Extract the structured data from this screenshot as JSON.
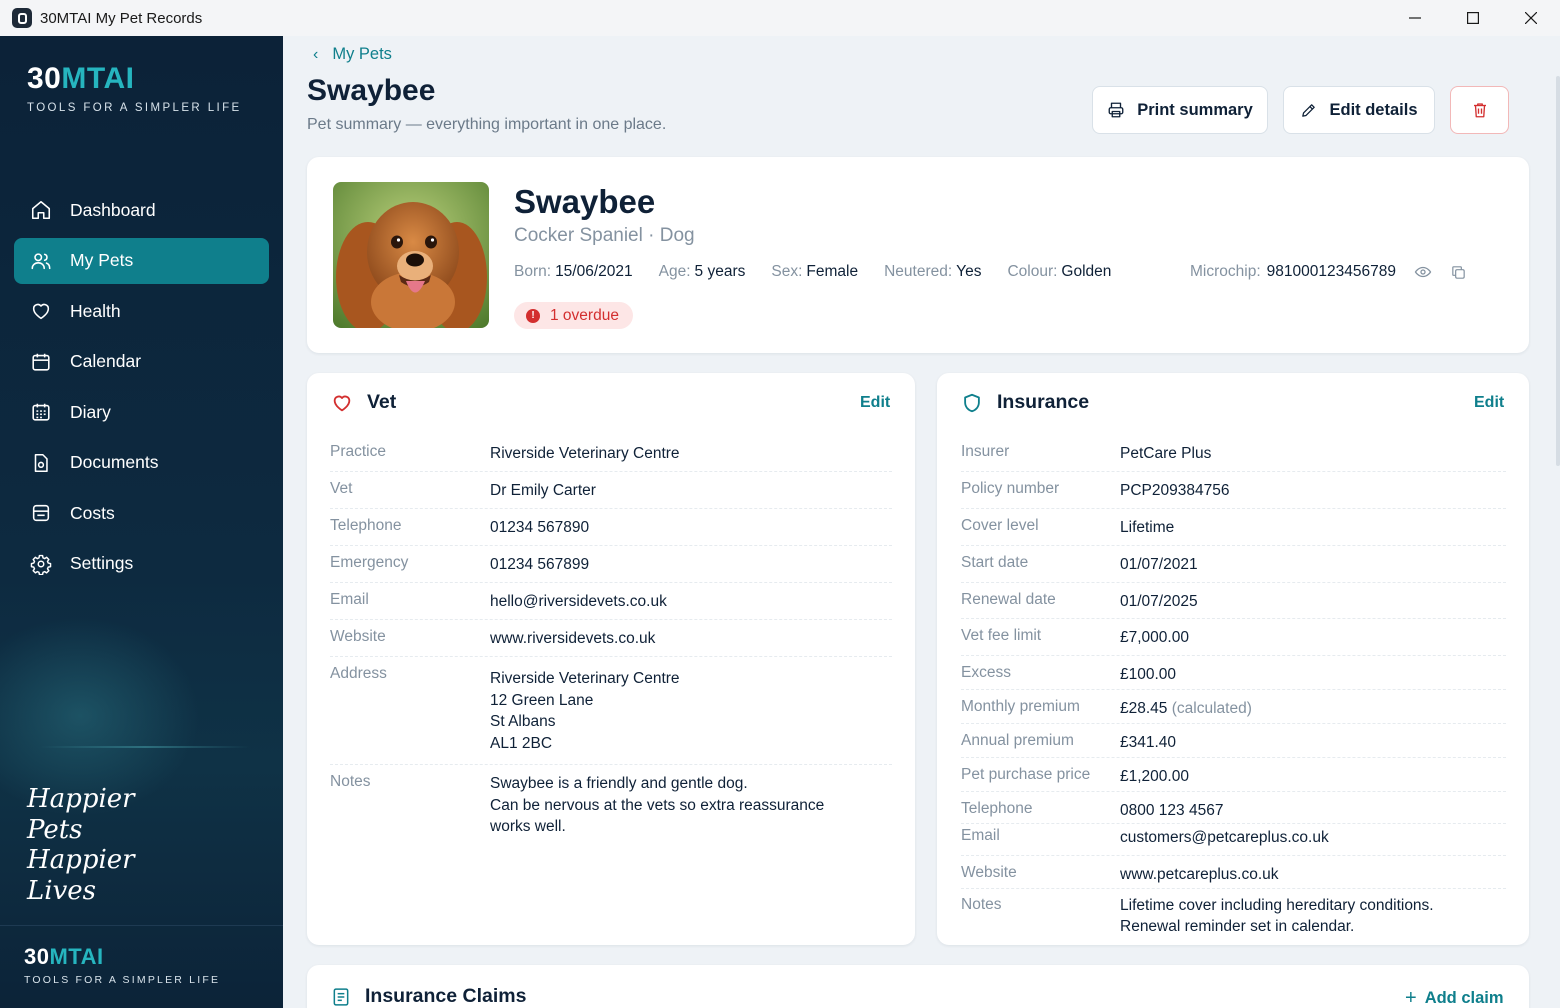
{
  "window": {
    "title": "30MTAI My Pet Records"
  },
  "brand": {
    "name_main": "30",
    "name_accent": "MTAI",
    "tagline": "TOOLS FOR A SIMPLER LIFE"
  },
  "nav": {
    "items": [
      {
        "label": "Dashboard",
        "icon": "home-icon"
      },
      {
        "label": "My Pets",
        "icon": "users-icon",
        "active": true
      },
      {
        "label": "Health",
        "icon": "heart-icon"
      },
      {
        "label": "Calendar",
        "icon": "calendar-icon"
      },
      {
        "label": "Diary",
        "icon": "diary-icon"
      },
      {
        "label": "Documents",
        "icon": "document-icon"
      },
      {
        "label": "Costs",
        "icon": "wallet-icon"
      },
      {
        "label": "Settings",
        "icon": "gear-icon"
      }
    ]
  },
  "slogan": {
    "line1": "Happier",
    "line2": "Pets",
    "line3": "Happier",
    "line4": "Lives"
  },
  "breadcrumb": {
    "label": "My Pets"
  },
  "page": {
    "title": "Swaybee",
    "subtitle": "Pet summary — everything important in one place."
  },
  "actions": {
    "print": "Print summary",
    "edit": "Edit details"
  },
  "pet": {
    "name": "Swaybee",
    "breed": "Cocker Spaniel · Dog",
    "born_label": "Born:",
    "born": "15/06/2021",
    "age_label": "Age:",
    "age": "5 years",
    "sex_label": "Sex:",
    "sex": "Female",
    "neutered_label": "Neutered:",
    "neutered": "Yes",
    "colour_label": "Colour:",
    "colour": "Golden",
    "microchip_label": "Microchip:",
    "microchip": "981000123456789",
    "overdue": "1 overdue"
  },
  "vet": {
    "title": "Vet",
    "edit": "Edit",
    "rows": [
      {
        "label": "Practice",
        "value": "Riverside Veterinary Centre"
      },
      {
        "label": "Vet",
        "value": "Dr Emily Carter"
      },
      {
        "label": "Telephone",
        "value": "01234 567890"
      },
      {
        "label": "Emergency",
        "value": "01234 567899"
      },
      {
        "label": "Email",
        "value": "hello@riversidevets.co.uk"
      },
      {
        "label": "Website",
        "value": "www.riversidevets.co.uk"
      },
      {
        "label": "Address",
        "value": [
          "Riverside Veterinary Centre",
          "12 Green Lane",
          "St Albans",
          "AL1 2BC"
        ]
      },
      {
        "label": "Notes",
        "value": [
          "Swaybee is a friendly and gentle dog.",
          "Can be nervous at the vets so extra reassurance",
          "works well."
        ]
      }
    ]
  },
  "insurance": {
    "title": "Insurance",
    "edit": "Edit",
    "rows": [
      {
        "label": "Insurer",
        "value": "PetCare Plus"
      },
      {
        "label": "Policy number",
        "value": "PCP209384756"
      },
      {
        "label": "Cover level",
        "value": "Lifetime"
      },
      {
        "label": "Start date",
        "value": "01/07/2021"
      },
      {
        "label": "Renewal date",
        "value": "01/07/2025"
      },
      {
        "label": "Vet fee limit",
        "value": "£7,000.00"
      },
      {
        "label": "Excess",
        "value": "£100.00"
      },
      {
        "label": "Monthly premium",
        "value": "£28.45",
        "note": "(calculated)"
      },
      {
        "label": "Annual premium",
        "value": "£341.40"
      },
      {
        "label": "Pet purchase price",
        "value": "£1,200.00"
      },
      {
        "label": "Telephone",
        "value": "0800 123 4567"
      },
      {
        "label": "Email",
        "value": "customers@petcareplus.co.uk"
      },
      {
        "label": "Website",
        "value": "www.petcareplus.co.uk"
      },
      {
        "label": "Notes",
        "value": [
          "Lifetime cover including hereditary conditions.",
          "Renewal reminder set in calendar."
        ]
      }
    ]
  },
  "claims": {
    "title": "Insurance Claims",
    "add": "Add claim"
  },
  "colors": {
    "accent": "#0f7f8c",
    "sidebar": "#0c2238",
    "danger": "#d32f2f"
  }
}
